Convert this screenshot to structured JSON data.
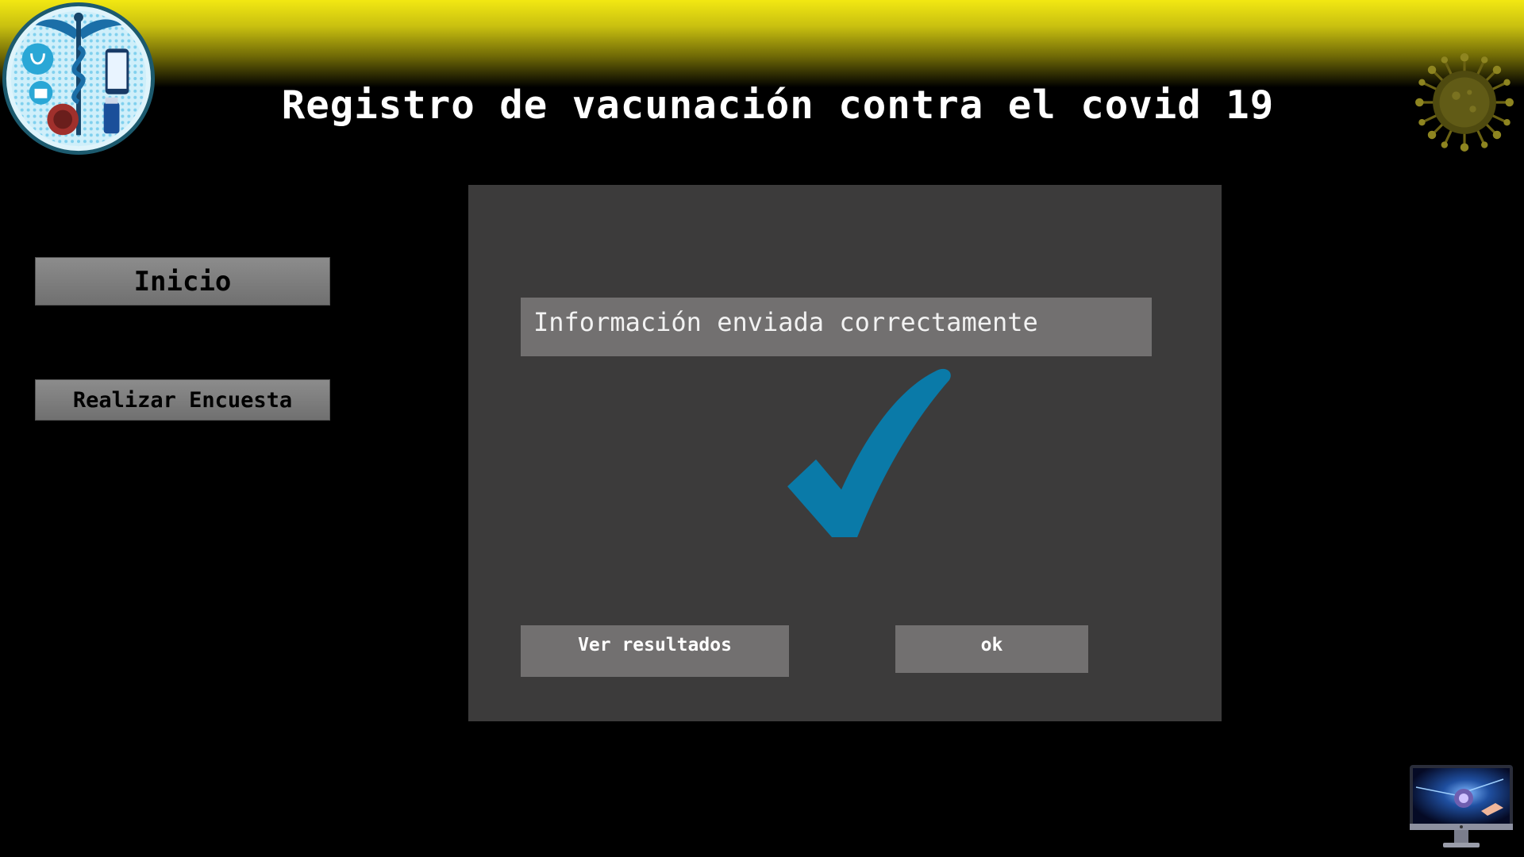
{
  "header": {
    "title": "Registro de vacunación contra el covid 19"
  },
  "sidebar": {
    "items": [
      {
        "label": "Inicio"
      },
      {
        "label": "Realizar Encuesta"
      }
    ]
  },
  "dialog": {
    "message": "Información enviada correctamente",
    "buttons": {
      "results_label": "Ver resultados",
      "ok_label": "ok"
    }
  },
  "colors": {
    "header_yellow": "#f2e812",
    "dialog_bg": "#3c3b3b",
    "field_bg": "#727070",
    "nav_button": "#7f7f7f",
    "check_blue": "#0a7aa8"
  },
  "icons": {
    "logo": "medical-caduceus-logo",
    "corner_top_right": "virus-icon",
    "corner_bottom_right": "monitor-icon",
    "dialog_status": "checkmark-icon"
  }
}
